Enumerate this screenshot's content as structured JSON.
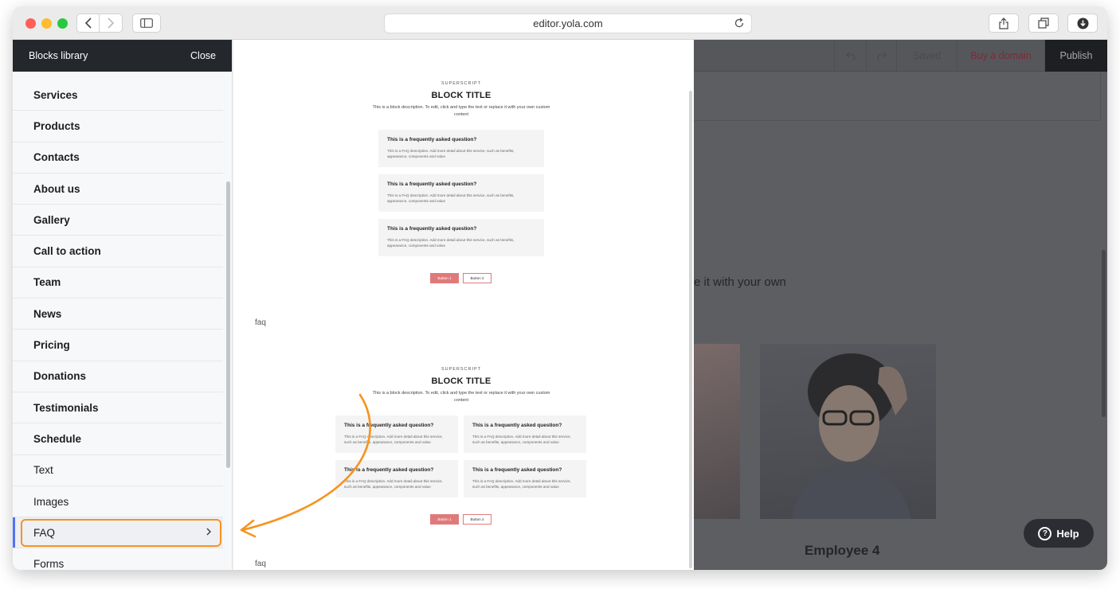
{
  "browser": {
    "url": "editor.yola.com"
  },
  "sidebar": {
    "title": "Blocks library",
    "close_label": "Close",
    "items": [
      {
        "label": "Services",
        "bold": true
      },
      {
        "label": "Products",
        "bold": true
      },
      {
        "label": "Contacts",
        "bold": true
      },
      {
        "label": "About us",
        "bold": true
      },
      {
        "label": "Gallery",
        "bold": true
      },
      {
        "label": "Call to action",
        "bold": true
      },
      {
        "label": "Team",
        "bold": true
      },
      {
        "label": "News",
        "bold": true
      },
      {
        "label": "Pricing",
        "bold": true
      },
      {
        "label": "Donations",
        "bold": true
      },
      {
        "label": "Testimonials",
        "bold": true
      },
      {
        "label": "Schedule",
        "bold": true
      },
      {
        "label": "Text",
        "bold": false
      },
      {
        "label": "Images",
        "bold": false
      },
      {
        "label": "FAQ",
        "bold": false,
        "active": true
      },
      {
        "label": "Forms",
        "bold": false
      }
    ]
  },
  "preview": {
    "blocks": [
      {
        "superscript": "SUPERSCRIPT",
        "title": "BLOCK TITLE",
        "description": "This is a block description. To edit, click and type the text or replace it with your own custom content",
        "faqs": [
          {
            "q": "This is a frequently asked question?",
            "a": "This is a FAQ description. Add more detail about this service, such as benefits, appearance, components and value"
          },
          {
            "q": "This is a frequently asked question?",
            "a": "This is a FAQ description. Add more detail about this service, such as benefits, appearance, components and value"
          },
          {
            "q": "This is a frequently asked question?",
            "a": "This is a FAQ description. Add more detail about this service, such as benefits, appearance, components and value"
          }
        ],
        "button1": "Button 1",
        "button2": "Button 2",
        "label": "faq"
      },
      {
        "superscript": "SUPERSCRIPT",
        "title": "BLOCK TITLE",
        "description": "This is a block description. To edit, click and type the text or replace it with your own custom content",
        "faqs": [
          {
            "q": "This is a frequently asked question?",
            "a": "This is a FAQ description. Add more detail about this service, such as benefits, appearance, components and value"
          },
          {
            "q": "This is a frequently asked question?",
            "a": "This is a FAQ description. Add more detail about this service, such as benefits, appearance, components and value"
          },
          {
            "q": "This is a frequently asked question?",
            "a": "This is a FAQ description. Add more detail about this service, such as benefits, appearance, components and value"
          },
          {
            "q": "This is a frequently asked question?",
            "a": "This is a FAQ description. Add more detail about this service, such as benefits, appearance, components and value"
          }
        ],
        "button1": "Button 1",
        "button2": "Button 2",
        "label": "faq"
      }
    ]
  },
  "editor": {
    "toolbar": {
      "saved_label": "Saved",
      "domain_label": "Buy a domain",
      "publish_label": "Publish"
    },
    "body_text": "e it with your own",
    "employee_label": "Employee 4",
    "help_label": "Help"
  },
  "colors": {
    "active_indicator": "#5472f5",
    "highlight": "#f7931e",
    "primary_button": "#e07a7a",
    "sidebar_header": "#24272c"
  }
}
